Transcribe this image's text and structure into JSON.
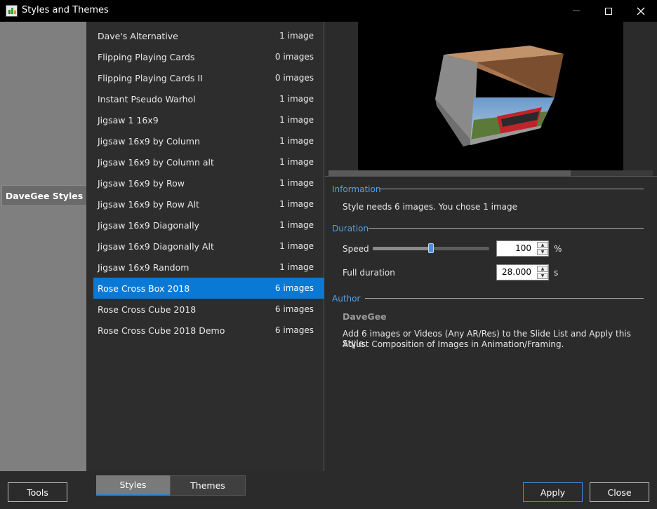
{
  "window": {
    "title": "Styles and Themes",
    "minimize_icon": "minimize-icon",
    "maximize_icon": "maximize-icon",
    "close_icon": "close-icon"
  },
  "categories": [
    {
      "label": "DaveGee Styles",
      "selected": true
    }
  ],
  "styles": [
    {
      "name": "Dave's Alternative",
      "count": "1 image"
    },
    {
      "name": "Flipping Playing Cards",
      "count": "0 images"
    },
    {
      "name": "Flipping Playing Cards II",
      "count": "0 images"
    },
    {
      "name": "Instant Pseudo Warhol",
      "count": "1 image"
    },
    {
      "name": "Jigsaw 1 16x9",
      "count": "1 image"
    },
    {
      "name": "Jigsaw 16x9 by Column",
      "count": "1 image"
    },
    {
      "name": "Jigsaw 16x9 by Column alt",
      "count": "1 image"
    },
    {
      "name": "Jigsaw 16x9 by Row",
      "count": "1 image"
    },
    {
      "name": "Jigsaw 16x9 by Row Alt",
      "count": "1 image"
    },
    {
      "name": "Jigsaw 16x9 Diagonally",
      "count": "1 image"
    },
    {
      "name": "Jigsaw 16x9 Diagonally Alt",
      "count": "1 image"
    },
    {
      "name": "Jigsaw 16x9 Random",
      "count": "1 image"
    },
    {
      "name": "Rose Cross Box 2018",
      "count": "6 images",
      "selected": true
    },
    {
      "name": "Rose Cross Cube 2018",
      "count": "6 images"
    },
    {
      "name": "Rose Cross Cube 2018 Demo",
      "count": "6 images"
    }
  ],
  "information": {
    "title": "Information",
    "text": "Style needs 6 images. You chose 1 image"
  },
  "duration": {
    "title": "Duration",
    "speed_label": "Speed",
    "speed_value": "100",
    "speed_unit": "%",
    "speed_slider_fraction": 0.5,
    "full_duration_label": "Full duration",
    "full_duration_value": "28.000",
    "full_duration_unit": "s"
  },
  "author": {
    "title": "Author",
    "name": "DaveGee",
    "description_line1": "Add 6 images or Videos (Any AR/Res) to the Slide List and Apply this Style.",
    "description_line2": "Adjust Composition of Images in Animation/Framing."
  },
  "bottom": {
    "tools_label": "Tools",
    "tab_styles": "Styles",
    "tab_themes": "Themes",
    "apply_label": "Apply",
    "close_label": "Close"
  },
  "colors": {
    "selection": "#0a79d6",
    "section_title": "#5aa0e0"
  }
}
